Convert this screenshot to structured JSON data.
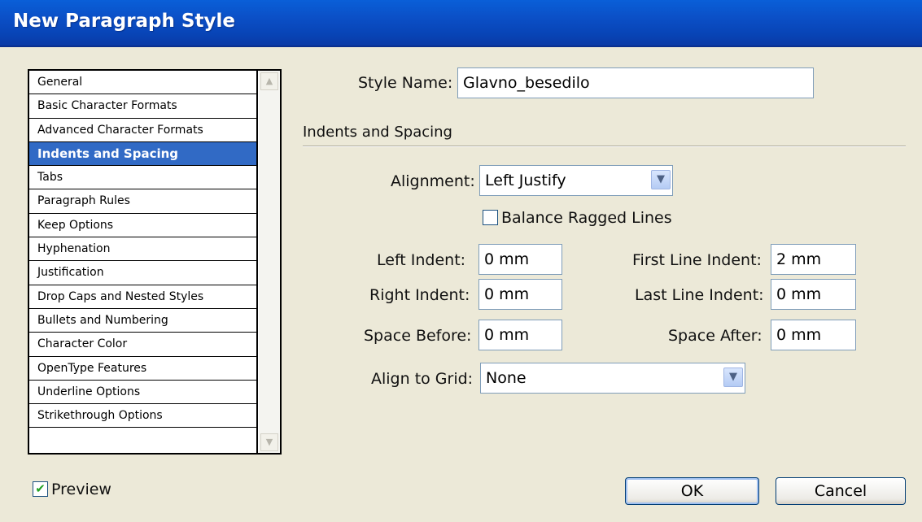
{
  "window": {
    "title": "New Paragraph Style"
  },
  "sidebar": {
    "items": [
      {
        "label": "General"
      },
      {
        "label": "Basic Character Formats"
      },
      {
        "label": "Advanced Character Formats"
      },
      {
        "label": "Indents and Spacing",
        "selected": true
      },
      {
        "label": "Tabs"
      },
      {
        "label": "Paragraph Rules"
      },
      {
        "label": "Keep Options"
      },
      {
        "label": "Hyphenation"
      },
      {
        "label": "Justification"
      },
      {
        "label": "Drop Caps and Nested Styles"
      },
      {
        "label": "Bullets and Numbering"
      },
      {
        "label": "Character Color"
      },
      {
        "label": "OpenType Features"
      },
      {
        "label": "Underline Options"
      },
      {
        "label": "Strikethrough Options"
      }
    ]
  },
  "style_name": {
    "label": "Style Name:",
    "value": "Glavno_besedilo"
  },
  "section": {
    "title": "Indents and Spacing"
  },
  "alignment": {
    "label": "Alignment:",
    "value": "Left Justify"
  },
  "balance": {
    "label": "Balance Ragged Lines",
    "checked": false
  },
  "left_indent": {
    "label": "Left Indent:",
    "value": "0 mm"
  },
  "right_indent": {
    "label": "Right Indent:",
    "value": "0 mm"
  },
  "first_line_indent": {
    "label": "First Line Indent:",
    "value": "2 mm"
  },
  "last_line_indent": {
    "label": "Last Line Indent:",
    "value": "0 mm"
  },
  "space_before": {
    "label": "Space Before:",
    "value": "0 mm"
  },
  "space_after": {
    "label": "Space After:",
    "value": "0 mm"
  },
  "align_grid": {
    "label": "Align to Grid:",
    "value": "None"
  },
  "preview": {
    "label": "Preview",
    "checked": true,
    "mark": "✔"
  },
  "buttons": {
    "ok": "OK",
    "cancel": "Cancel"
  },
  "icons": {
    "chevron_down": "chevron-down-icon",
    "scroll_up": "scroll-up-icon",
    "scroll_down": "scroll-down-icon"
  }
}
